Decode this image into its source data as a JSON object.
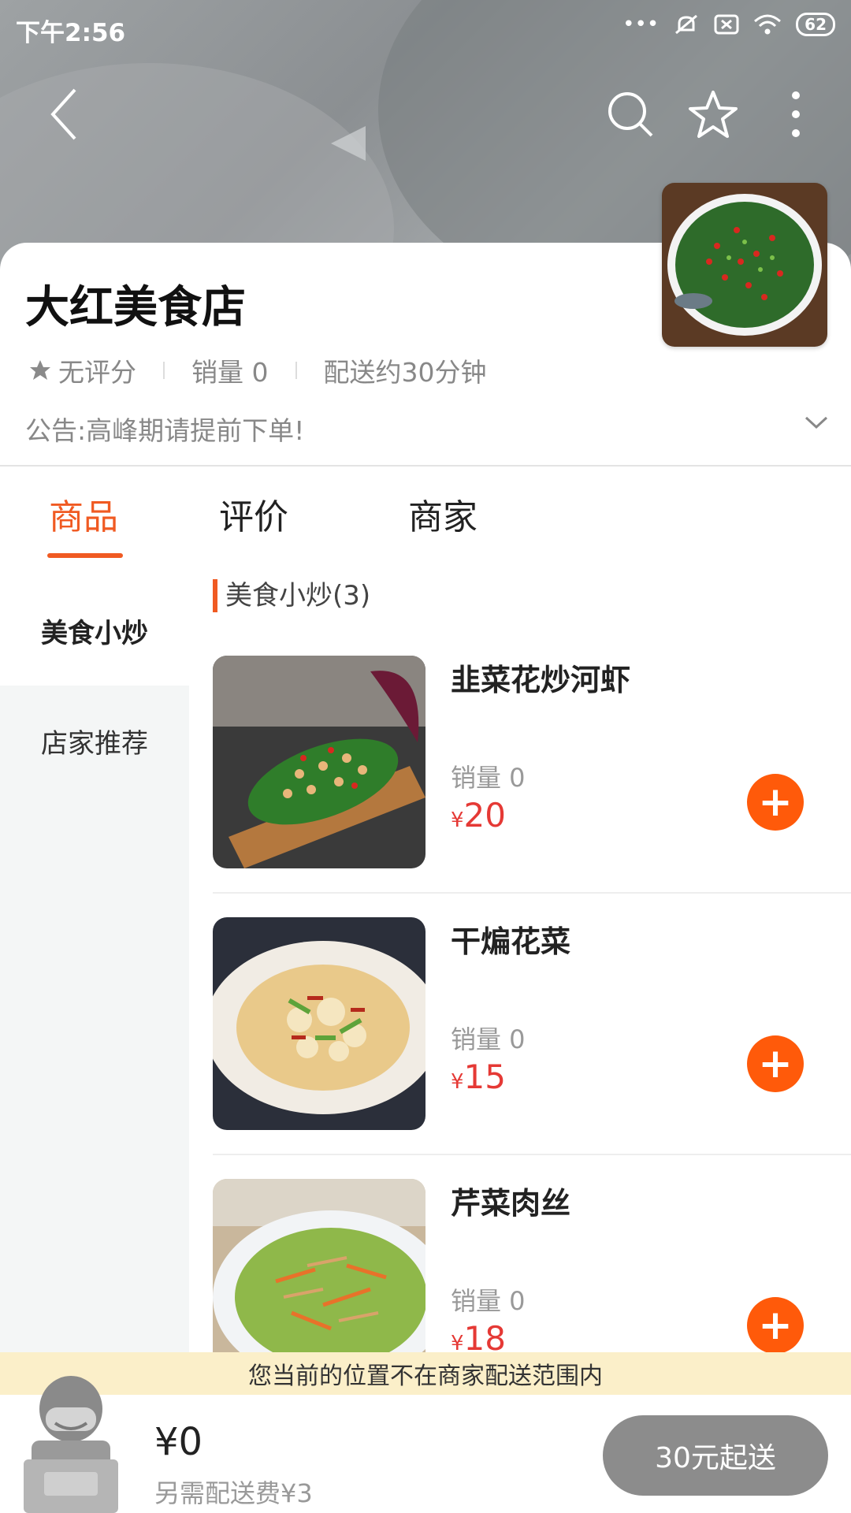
{
  "status": {
    "time": "下午2:56",
    "battery": "62"
  },
  "icons": {
    "back": "back-arrow-icon",
    "search": "search-icon",
    "favorite": "star-outline-icon",
    "more": "more-vertical-icon",
    "expand": "chevron-down-icon",
    "rating_star": "star-icon",
    "add": "plus-icon"
  },
  "shop": {
    "name": "大红美食店",
    "rating": "无评分",
    "sales": "销量 0",
    "delivery_time": "配送约30分钟",
    "notice": "公告:高峰期请提前下单!"
  },
  "tabs": [
    {
      "label": "商品",
      "active": true
    },
    {
      "label": "评价",
      "active": false
    },
    {
      "label": "商家",
      "active": false
    }
  ],
  "sidebar": {
    "items": [
      {
        "label": "美食小炒",
        "active": true
      },
      {
        "label": "店家推荐",
        "active": false
      }
    ]
  },
  "section": {
    "title": "美食小炒(3)"
  },
  "products": [
    {
      "name": "韭菜花炒河虾",
      "sales": "销量 0",
      "currency": "¥",
      "price": "20"
    },
    {
      "name": "干煸花菜",
      "sales": "销量 0",
      "currency": "¥",
      "price": "15"
    },
    {
      "name": "芹菜肉丝",
      "sales": "销量 0",
      "currency": "¥",
      "price": "18"
    }
  ],
  "banner": {
    "range_notice": "您当前的位置不在商家配送范围内"
  },
  "cart": {
    "total": "¥0",
    "delivery_fee": "另需配送费¥3",
    "min_order_button": "30元起送"
  },
  "colors": {
    "accent": "#f05a22",
    "price": "#e53935",
    "add_button": "#ff5a0a",
    "banner_bg": "#fbefc9",
    "disabled_button": "#8c8c8c"
  }
}
